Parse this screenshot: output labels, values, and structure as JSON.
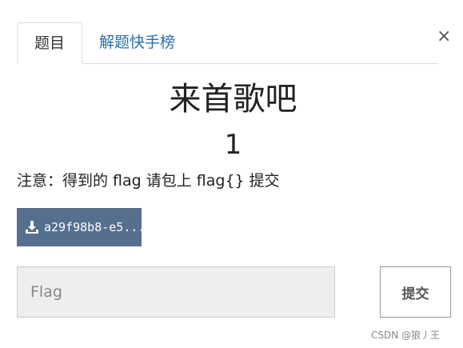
{
  "tabs": [
    {
      "label": "题目",
      "active": true
    },
    {
      "label": "解题快手榜",
      "active": false
    }
  ],
  "close_symbol": "×",
  "challenge": {
    "title": "来首歌吧",
    "points": "1",
    "note": "注意：得到的 flag 请包上 flag{} 提交"
  },
  "download": {
    "label": "a29f98b8-e5...",
    "icon": "download-icon"
  },
  "form": {
    "flag_placeholder": "Flag",
    "flag_value": "",
    "submit_label": "提交"
  },
  "watermark": "CSDN @狼丿王",
  "colors": {
    "download_button": "#566f8f",
    "tab_link": "#2a6fad",
    "input_background": "#eeeeee"
  }
}
